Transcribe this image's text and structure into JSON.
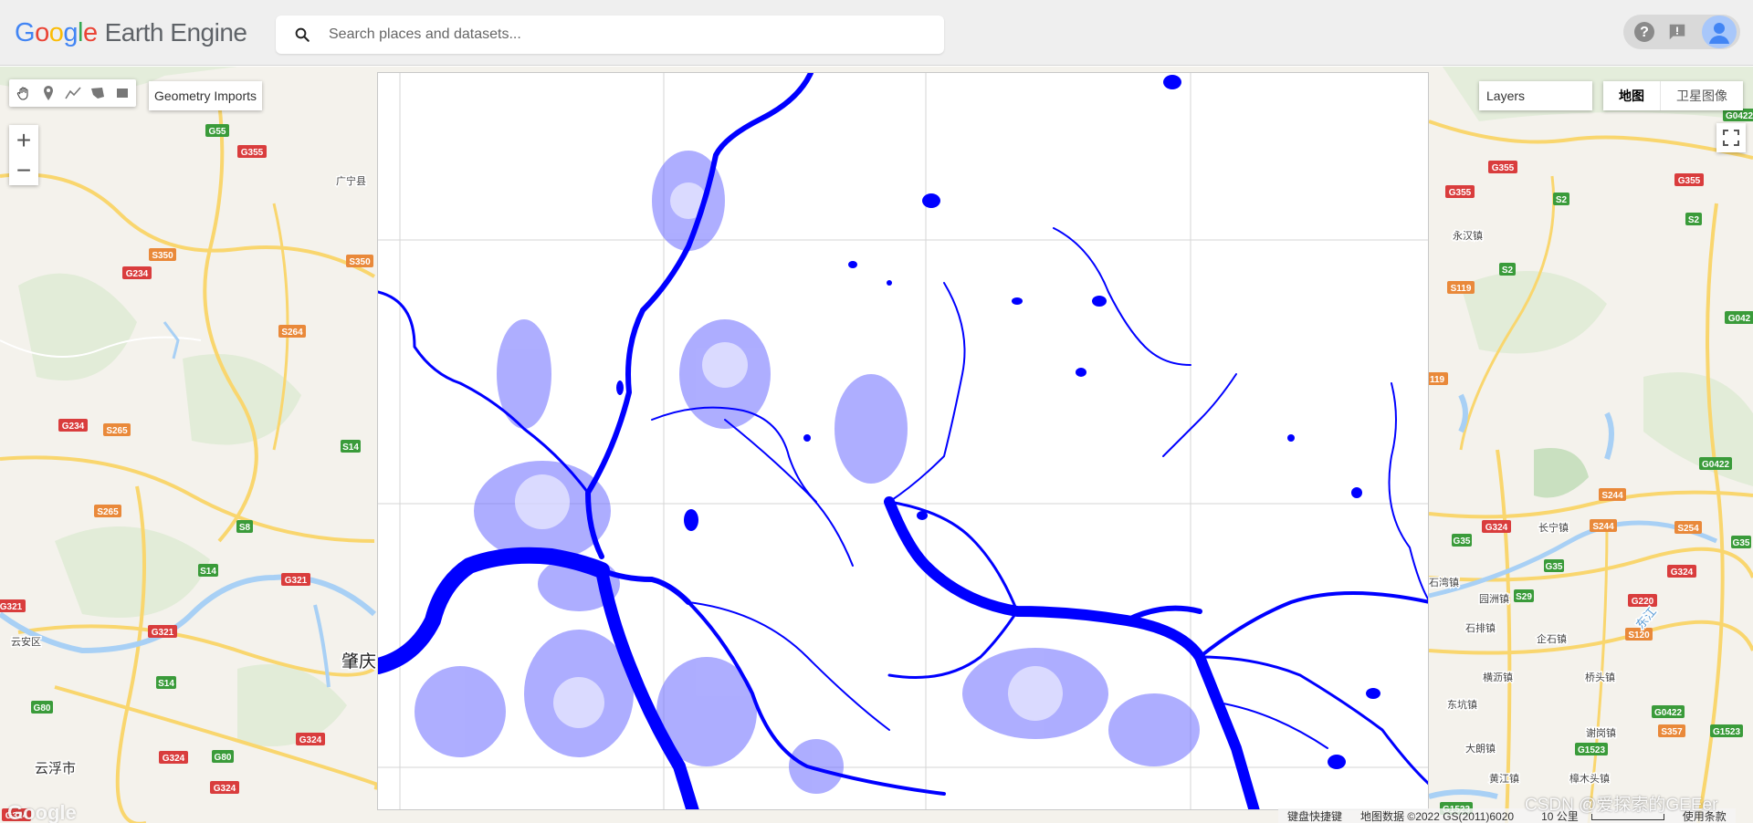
{
  "header": {
    "logo_letters": [
      "G",
      "o",
      "o",
      "g",
      "l",
      "e"
    ],
    "product_name": "Earth Engine",
    "search_placeholder": "Search places and datasets...",
    "help_icon": "question-mark-icon",
    "feedback_icon": "feedback-icon",
    "account_icon": "user-avatar-icon"
  },
  "toolbar": {
    "tools": [
      {
        "name": "pan-hand-icon"
      },
      {
        "name": "point-marker-icon"
      },
      {
        "name": "line-icon"
      },
      {
        "name": "polygon-icon"
      },
      {
        "name": "rectangle-icon"
      }
    ],
    "geometry_imports": "Geometry Imports"
  },
  "zoom": {
    "in": "+",
    "out": "−"
  },
  "layers": {
    "label": "Layers"
  },
  "map_type": {
    "map": "地图",
    "satellite": "卫星图像"
  },
  "fullscreen_icon": "fullscreen-icon",
  "map_labels": {
    "left": [
      {
        "text": "G55",
        "kind": "green"
      },
      {
        "text": "G355",
        "kind": "red"
      },
      {
        "text": "广宁县",
        "kind": "place"
      },
      {
        "text": "S350",
        "kind": "orange"
      },
      {
        "text": "G234",
        "kind": "red"
      },
      {
        "text": "S350",
        "kind": "orange"
      },
      {
        "text": "S264",
        "kind": "orange"
      },
      {
        "text": "G234",
        "kind": "red"
      },
      {
        "text": "S265",
        "kind": "orange"
      },
      {
        "text": "S14",
        "kind": "green"
      },
      {
        "text": "S265",
        "kind": "orange"
      },
      {
        "text": "S8",
        "kind": "green"
      },
      {
        "text": "S14",
        "kind": "green"
      },
      {
        "text": "G321",
        "kind": "red"
      },
      {
        "text": "G321",
        "kind": "red"
      },
      {
        "text": "G321",
        "kind": "red"
      },
      {
        "text": "云安区",
        "kind": "place"
      },
      {
        "text": "肇庆",
        "kind": "city"
      },
      {
        "text": "S14",
        "kind": "green"
      },
      {
        "text": "G80",
        "kind": "green"
      },
      {
        "text": "G324",
        "kind": "red"
      },
      {
        "text": "G80",
        "kind": "green"
      },
      {
        "text": "G324",
        "kind": "red"
      },
      {
        "text": "云浮市",
        "kind": "bigplace"
      },
      {
        "text": "G324",
        "kind": "red"
      },
      {
        "text": "G324",
        "kind": "red"
      }
    ],
    "right": [
      {
        "text": "G0422",
        "kind": "green"
      },
      {
        "text": "G355",
        "kind": "red"
      },
      {
        "text": "G355",
        "kind": "red"
      },
      {
        "text": "G355",
        "kind": "red"
      },
      {
        "text": "S2",
        "kind": "green"
      },
      {
        "text": "S2",
        "kind": "green"
      },
      {
        "text": "永汉镇",
        "kind": "place"
      },
      {
        "text": "S2",
        "kind": "green"
      },
      {
        "text": "S119",
        "kind": "orange"
      },
      {
        "text": "G042",
        "kind": "green"
      },
      {
        "text": "119",
        "kind": "orange"
      },
      {
        "text": "G0422",
        "kind": "green"
      },
      {
        "text": "S244",
        "kind": "orange"
      },
      {
        "text": "G324",
        "kind": "red"
      },
      {
        "text": "长宁镇",
        "kind": "place"
      },
      {
        "text": "S244",
        "kind": "orange"
      },
      {
        "text": "S254",
        "kind": "orange"
      },
      {
        "text": "G35",
        "kind": "green"
      },
      {
        "text": "G35",
        "kind": "green"
      },
      {
        "text": "G35",
        "kind": "green"
      },
      {
        "text": "G324",
        "kind": "red"
      },
      {
        "text": "石湾镇",
        "kind": "place"
      },
      {
        "text": "园洲镇",
        "kind": "place"
      },
      {
        "text": "S29",
        "kind": "green"
      },
      {
        "text": "G220",
        "kind": "red"
      },
      {
        "text": "石排镇",
        "kind": "place"
      },
      {
        "text": "企石镇",
        "kind": "place"
      },
      {
        "text": "S120",
        "kind": "orange"
      },
      {
        "text": "东江",
        "kind": "river"
      },
      {
        "text": "横沥镇",
        "kind": "place"
      },
      {
        "text": "桥头镇",
        "kind": "place"
      },
      {
        "text": "东坑镇",
        "kind": "place"
      },
      {
        "text": "G0422",
        "kind": "green"
      },
      {
        "text": "大朗镇",
        "kind": "place"
      },
      {
        "text": "谢岗镇",
        "kind": "place"
      },
      {
        "text": "S357",
        "kind": "orange"
      },
      {
        "text": "G1523",
        "kind": "green"
      },
      {
        "text": "G1523",
        "kind": "green"
      },
      {
        "text": "黄江镇",
        "kind": "place"
      },
      {
        "text": "樟木头镇",
        "kind": "place"
      },
      {
        "text": "G1523",
        "kind": "green"
      }
    ]
  },
  "footer": {
    "google_watermark": "Google",
    "shortcuts": "键盘快捷键",
    "map_data": "地图数据 ©2022 GS(2011)6020",
    "scale": "10 公里",
    "terms": "使用条款",
    "csdn_watermark": "CSDN @爱探索的GEEer"
  },
  "colors": {
    "water_mask": "#0000ff",
    "header_bg": "#efefef",
    "map_bg": "#f4f2ec",
    "road_yellow": "#f9d66e",
    "shield_red": "#d93d3d",
    "shield_green": "#3a9b3a",
    "shield_orange": "#e9893a"
  }
}
